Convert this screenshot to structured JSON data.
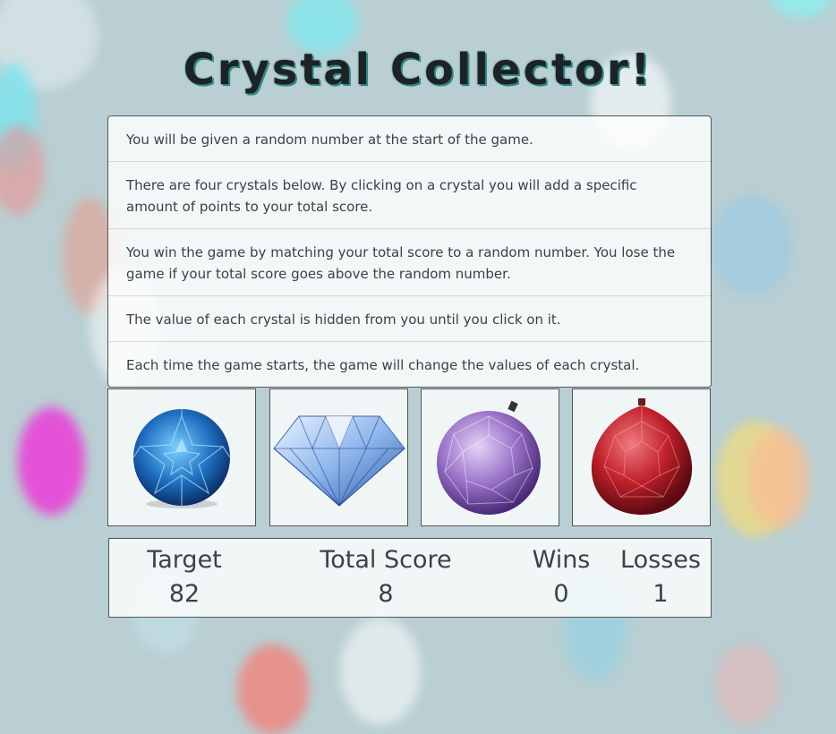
{
  "title": "Crystal Collector!",
  "instructions": [
    "You will be given a random number at the start of the game.",
    "There are four crystals below. By clicking on a crystal you will add a specific amount of points to your total score.",
    "You win the game by matching your total score to a random number. You lose the game if your total score goes above the random number.",
    "The value of each crystal is hidden from you until you click on it.",
    "Each time the game starts, the game will change the values of each crystal."
  ],
  "crystals": [
    {
      "icon": "blue-round-gem-icon",
      "color": "#1f6fc0"
    },
    {
      "icon": "clear-diamond-icon",
      "color": "#a9c8f0"
    },
    {
      "icon": "purple-crystal-ball-icon",
      "color": "#9a73c9"
    },
    {
      "icon": "red-crystal-ball-icon",
      "color": "#c0202a"
    }
  ],
  "stats": {
    "target": {
      "label": "Target",
      "value": "82"
    },
    "total_score": {
      "label": "Total Score",
      "value": "8"
    },
    "wins": {
      "label": "Wins",
      "value": "0"
    },
    "losses": {
      "label": "Losses",
      "value": "1"
    }
  },
  "colors": {
    "background": "#b9cfd3",
    "title_text": "#1e2226",
    "title_shadow": "#2e8a86",
    "panel_border": "#555555"
  }
}
